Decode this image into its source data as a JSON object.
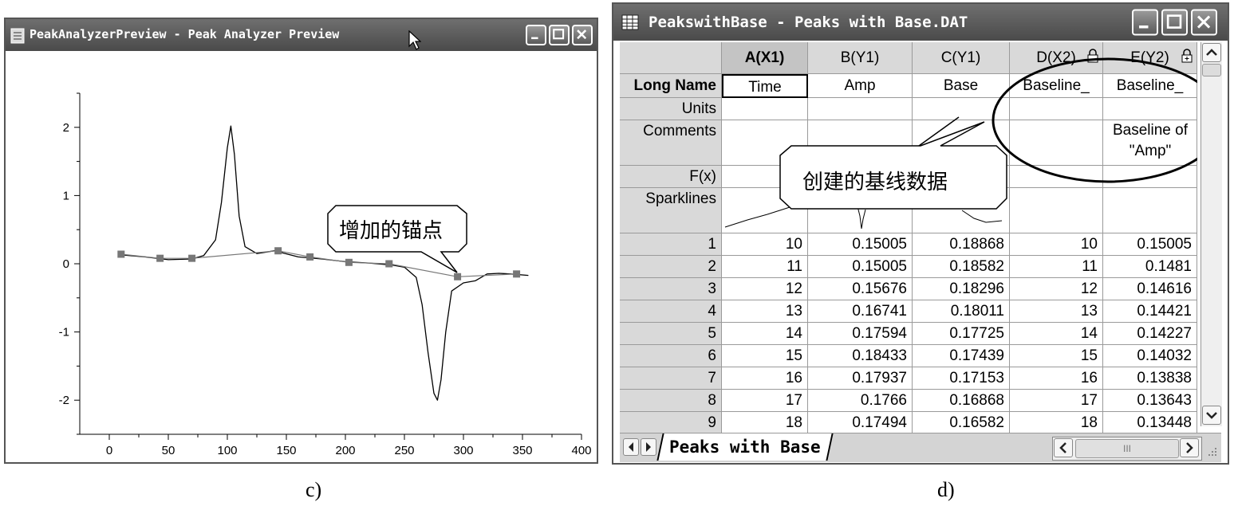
{
  "captions": {
    "left": "c)",
    "right": "d)"
  },
  "left_window": {
    "title": "PeakAnalyzerPreview - Peak Analyzer Preview",
    "callout": "增加的锚点",
    "chart_data": {
      "type": "line",
      "x_ticks": [
        "0",
        "50",
        "100",
        "150",
        "200",
        "250",
        "300",
        "350",
        "400"
      ],
      "y_ticks": [
        "2",
        "1",
        "0",
        "-1",
        "-2"
      ],
      "xlim": [
        -25,
        400
      ],
      "ylim": [
        -2.5,
        2.5
      ],
      "series": [
        {
          "style": "curve",
          "x": [
            10,
            30,
            50,
            70,
            80,
            90,
            95,
            100,
            103,
            106,
            110,
            115,
            125,
            140,
            160,
            180,
            200,
            220,
            240,
            250,
            260,
            265,
            270,
            275,
            278,
            281,
            285,
            290,
            300,
            310,
            320,
            330,
            340,
            355
          ],
          "y": [
            0.13,
            0.1,
            0.06,
            0.07,
            0.12,
            0.35,
            0.9,
            1.7,
            2.02,
            1.6,
            0.7,
            0.25,
            0.15,
            0.19,
            0.1,
            0.07,
            0.03,
            0.01,
            -0.02,
            -0.05,
            -0.2,
            -0.6,
            -1.3,
            -1.9,
            -2.0,
            -1.7,
            -1.0,
            -0.4,
            -0.28,
            -0.25,
            -0.15,
            -0.14,
            -0.15,
            -0.17
          ]
        },
        {
          "style": "anchor",
          "x": [
            10,
            43,
            70,
            143,
            170,
            203,
            237,
            295,
            345
          ],
          "y": [
            0.14,
            0.08,
            0.08,
            0.19,
            0.1,
            0.02,
            0.0,
            -0.19,
            -0.15
          ]
        }
      ]
    }
  },
  "right_window": {
    "title": "PeakswithBase - Peaks with Base.DAT",
    "callout": "创建的基线数据",
    "columns": [
      "A(X1)",
      "B(Y1)",
      "C(Y1)",
      "D(X2)",
      "E(Y2)"
    ],
    "row_labels": {
      "long_name": "Long Name",
      "units": "Units",
      "comments": "Comments",
      "fx": "F(x)",
      "sparklines": "Sparklines"
    },
    "long_names": [
      "Time",
      "Amp",
      "Base",
      "Baseline_",
      "Baseline_"
    ],
    "comment_e_line1": "Baseline of",
    "comment_e_line2": "\"Amp\"",
    "rows": [
      [
        "1",
        "10",
        "0.15005",
        "0.18868",
        "10",
        "0.15005"
      ],
      [
        "2",
        "11",
        "0.15005",
        "0.18582",
        "11",
        "0.1481"
      ],
      [
        "3",
        "12",
        "0.15676",
        "0.18296",
        "12",
        "0.14616"
      ],
      [
        "4",
        "13",
        "0.16741",
        "0.18011",
        "13",
        "0.14421"
      ],
      [
        "5",
        "14",
        "0.17594",
        "0.17725",
        "14",
        "0.14227"
      ],
      [
        "6",
        "15",
        "0.18433",
        "0.17439",
        "15",
        "0.14032"
      ],
      [
        "7",
        "16",
        "0.17937",
        "0.17153",
        "16",
        "0.13838"
      ],
      [
        "8",
        "17",
        "0.1766",
        "0.16868",
        "17",
        "0.13643"
      ],
      [
        "9",
        "18",
        "0.17494",
        "0.16582",
        "18",
        "0.13448"
      ]
    ],
    "sheet_tab": "Peaks with Base",
    "hscroll_grip": "III"
  }
}
